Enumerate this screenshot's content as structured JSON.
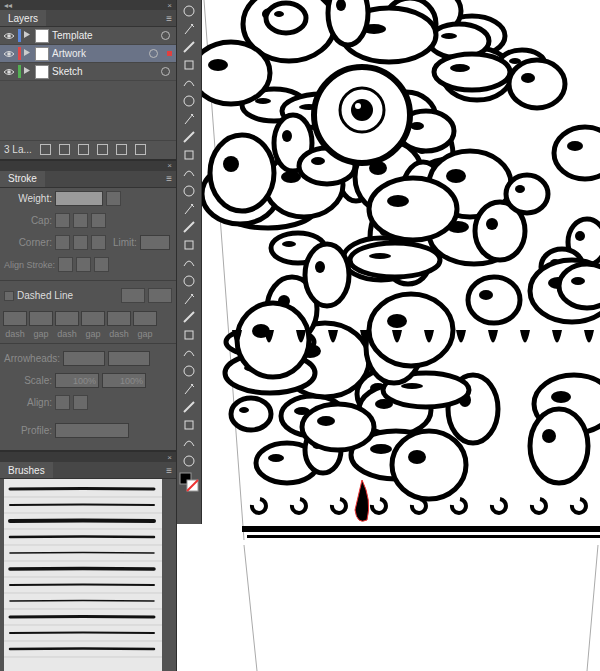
{
  "layers_panel": {
    "collapse": "◂◂",
    "close": "×",
    "title": "Layers",
    "menu": "≡",
    "layers": [
      {
        "name": "Template",
        "visible": true,
        "selected": false,
        "color": "#5b86d9"
      },
      {
        "name": "Artwork",
        "visible": true,
        "selected": true,
        "color": "#e04848"
      },
      {
        "name": "Sketch",
        "visible": true,
        "selected": false,
        "color": "#53b053"
      }
    ],
    "count": "3 La..."
  },
  "stroke_panel": {
    "close": "×",
    "title": "Stroke",
    "menu": "≡",
    "weight_label": "Weight:",
    "cap_label": "Cap:",
    "corner_label": "Corner:",
    "limit_label": "Limit:",
    "align_label": "Align Stroke:",
    "dashed_label": "Dashed Line",
    "dashed_checked": false,
    "dash_fields": [
      "dash",
      "gap",
      "dash",
      "gap",
      "dash",
      "gap"
    ],
    "arrowheads_label": "Arrowheads:",
    "scale_label": "Scale:",
    "scale_values": [
      "100%",
      "100%"
    ],
    "align2_label": "Align:",
    "profile_label": "Profile:"
  },
  "brushes_panel": {
    "close": "×",
    "title": "Brushes",
    "menu": "≡"
  }
}
